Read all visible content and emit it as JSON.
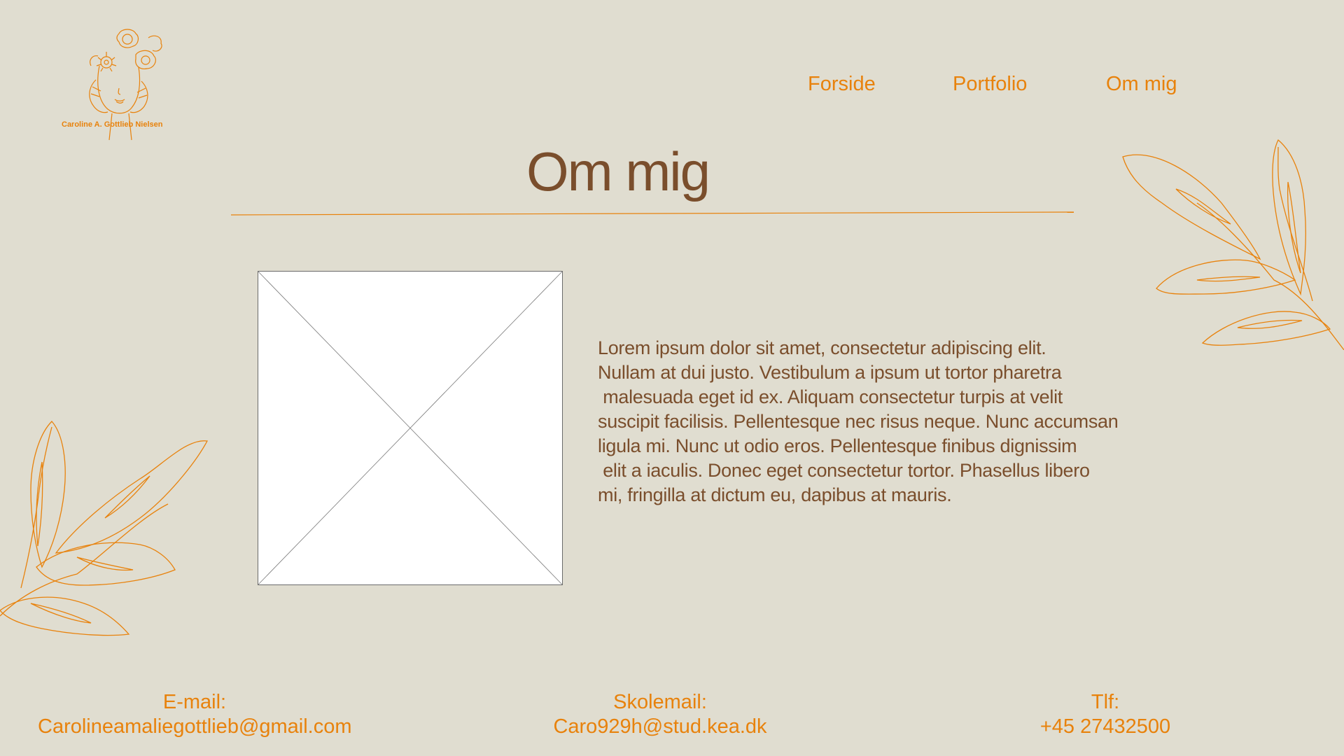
{
  "logo": {
    "icon": "line-art-woman-with-flowers-icon",
    "text": "Caroline A. Gottlieb Nielsen"
  },
  "nav": {
    "items": [
      {
        "label": "Forside"
      },
      {
        "label": "Portfolio"
      },
      {
        "label": "Om mig"
      }
    ]
  },
  "page": {
    "title": "Om mig"
  },
  "about": {
    "image_icon": "image-placeholder-icon",
    "lines": [
      "Lorem ipsum dolor sit amet, consectetur adipiscing elit.",
      "Nullam at dui justo. Vestibulum a ipsum ut tortor pharetra",
      " malesuada eget id ex. Aliquam consectetur turpis at velit",
      "suscipit facilisis. Pellentesque nec risus neque. Nunc accumsan",
      "ligula mi. Nunc ut odio eros. Pellentesque finibus dignissim",
      " elit a iaculis. Donec eget consectetur tortor. Phasellus libero",
      "mi, fringilla at dictum eu, dapibus at mauris."
    ]
  },
  "footer": {
    "email": {
      "label": "E-mail:",
      "value": "Carolineamaliegottlieb@gmail.com"
    },
    "school_email": {
      "label": "Skolemail:",
      "value": "Caro929h@stud.kea.dk"
    },
    "phone": {
      "label": "Tlf:",
      "value": "+45 27432500"
    }
  },
  "colors": {
    "background": "#e0ddd0",
    "accent": "#e8820c",
    "heading": "#7a4e2c"
  },
  "decorations": {
    "top_right": "leaf-branch-icon",
    "bottom_left": "leaf-branch-icon"
  }
}
